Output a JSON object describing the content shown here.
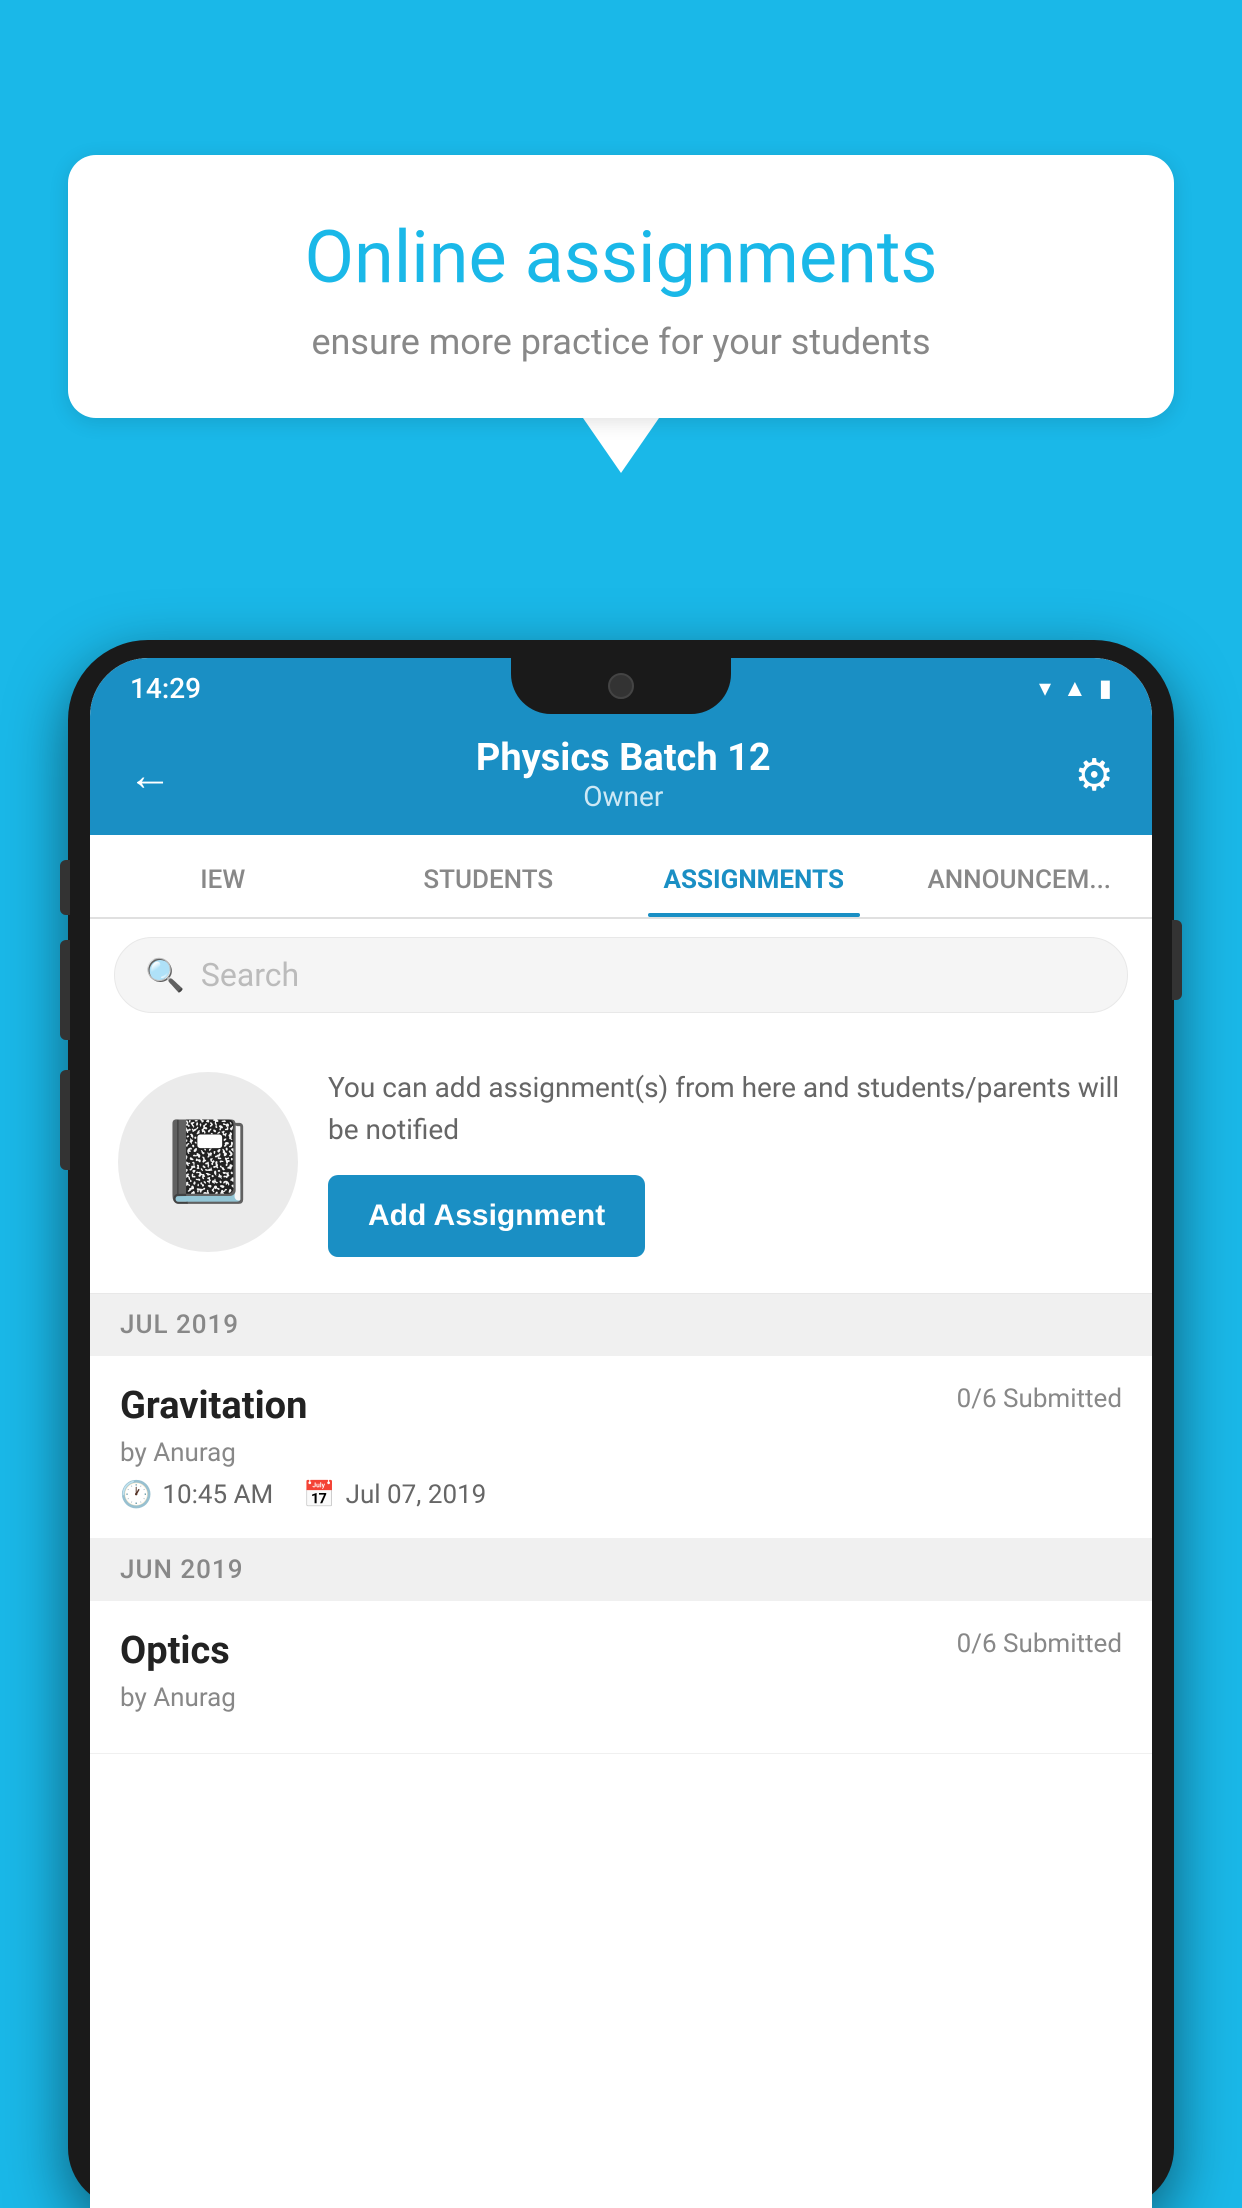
{
  "background_color": "#1ab8e8",
  "speech_bubble": {
    "title": "Online assignments",
    "subtitle": "ensure more practice for your students"
  },
  "phone": {
    "status_bar": {
      "time": "14:29",
      "icons": [
        "wifi",
        "signal",
        "battery"
      ]
    },
    "header": {
      "title": "Physics Batch 12",
      "subtitle": "Owner",
      "back_label": "←",
      "gear_label": "⚙"
    },
    "tabs": [
      {
        "label": "IEW",
        "active": false
      },
      {
        "label": "STUDENTS",
        "active": false
      },
      {
        "label": "ASSIGNMENTS",
        "active": true
      },
      {
        "label": "ANNOUNCEM...",
        "active": false
      }
    ],
    "search": {
      "placeholder": "Search"
    },
    "promo": {
      "description": "You can add assignment(s) from here and students/parents will be notified",
      "button_label": "Add Assignment"
    },
    "sections": [
      {
        "header": "JUL 2019",
        "assignments": [
          {
            "name": "Gravitation",
            "submitted": "0/6 Submitted",
            "by": "by Anurag",
            "time": "10:45 AM",
            "date": "Jul 07, 2019"
          }
        ]
      },
      {
        "header": "JUN 2019",
        "assignments": [
          {
            "name": "Optics",
            "submitted": "0/6 Submitted",
            "by": "by Anurag",
            "time": "",
            "date": ""
          }
        ]
      }
    ]
  }
}
